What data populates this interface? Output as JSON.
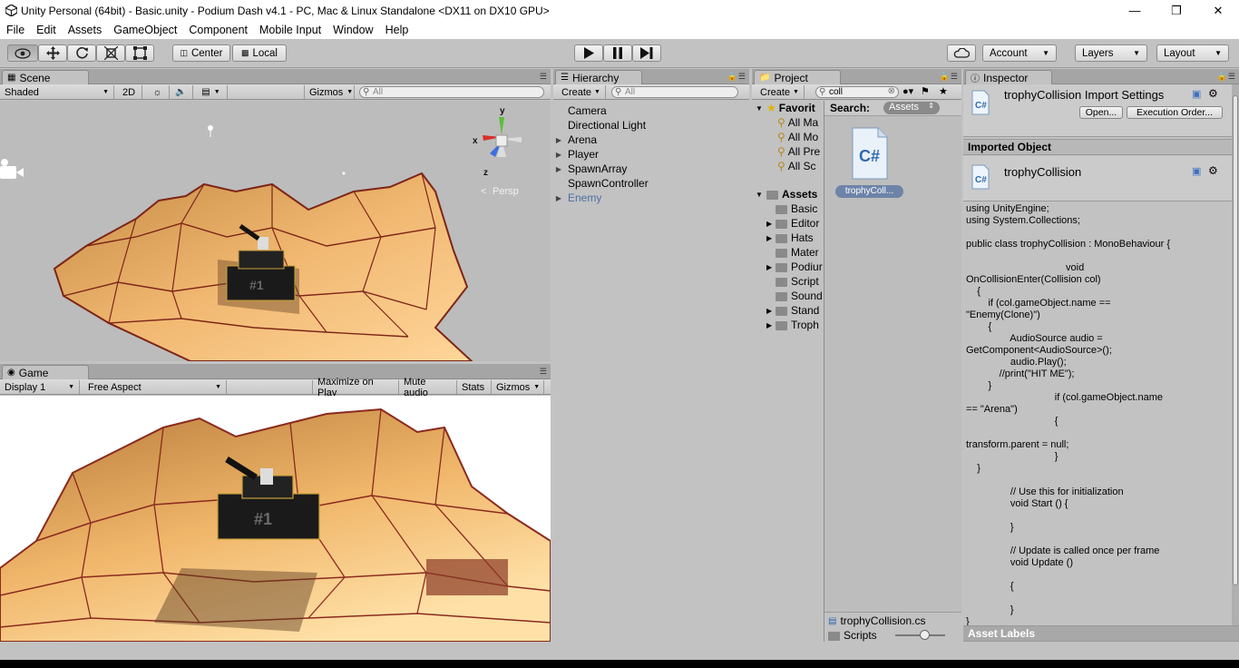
{
  "window": {
    "title": "Unity Personal (64bit) - Basic.unity - Podium Dash v4.1 - PC, Mac & Linux Standalone <DX11 on DX10 GPU>"
  },
  "menu": [
    "File",
    "Edit",
    "Assets",
    "GameObject",
    "Component",
    "Mobile Input",
    "Window",
    "Help"
  ],
  "toolbar": {
    "center": "Center",
    "local": "Local",
    "account": "Account",
    "layers": "Layers",
    "layout": "Layout"
  },
  "scene": {
    "tab": "Scene",
    "shading": "Shaded",
    "mode2d": "2D",
    "gizmos": "Gizmos",
    "search_placeholder": "All",
    "persp": "Persp",
    "axis_x": "x",
    "axis_y": "y",
    "axis_z": "z"
  },
  "game": {
    "tab": "Game",
    "display": "Display 1",
    "aspect": "Free Aspect",
    "maximize": "Maximize on Play",
    "mute": "Mute audio",
    "stats": "Stats",
    "gizmos": "Gizmos"
  },
  "hierarchy": {
    "tab": "Hierarchy",
    "create": "Create",
    "search_placeholder": "All",
    "items": [
      {
        "label": "Camera",
        "arrow": ""
      },
      {
        "label": "Directional Light",
        "arrow": ""
      },
      {
        "label": "Arena",
        "arrow": "▶"
      },
      {
        "label": "Player",
        "arrow": "▶"
      },
      {
        "label": "SpawnArray",
        "arrow": "▶"
      },
      {
        "label": "SpawnController",
        "arrow": ""
      },
      {
        "label": "Enemy",
        "arrow": "▶"
      }
    ]
  },
  "project": {
    "tab": "Project",
    "create": "Create",
    "search_value": "coll",
    "search_label": "Search:",
    "search_scope": "Assets",
    "favorites_label": "Favorit",
    "favorites": [
      "All Ma",
      "All Mo",
      "All Pre",
      "All Sc"
    ],
    "assets_label": "Assets",
    "assets": [
      {
        "label": "Basic",
        "arrow": ""
      },
      {
        "label": "Editor",
        "arrow": "▶"
      },
      {
        "label": "Hats",
        "arrow": "▶"
      },
      {
        "label": "Mater",
        "arrow": ""
      },
      {
        "label": "Podiur",
        "arrow": "▶"
      },
      {
        "label": "Script",
        "arrow": ""
      },
      {
        "label": "Sound",
        "arrow": ""
      },
      {
        "label": "Stand",
        "arrow": "▶"
      },
      {
        "label": "Troph",
        "arrow": "▶"
      }
    ],
    "result_name": "trophyColl...",
    "result_icon": "C#",
    "footer_file": "trophyCollision.cs",
    "footer_folder": "Scripts"
  },
  "inspector": {
    "tab": "Inspector",
    "title": "trophyCollision Import Settings",
    "open": "Open...",
    "exec_order": "Execution Order...",
    "imported_object": "Imported Object",
    "object_name": "trophyCollision",
    "code": "using UnityEngine;\nusing System.Collections;\n\npublic class trophyCollision : MonoBehaviour {\n\n                                    void\nOnCollisionEnter(Collision col)\n    {\n        if (col.gameObject.name ==\n\"Enemy(Clone)\")\n        {\n                AudioSource audio =\nGetComponent<AudioSource>();\n                audio.Play();\n            //print(\"HIT ME\");\n        }\n                                if (col.gameObject.name\n== \"Arena\")\n                                {\n\ntransform.parent = null;\n                                }\n    }\n\n                // Use this for initialization\n                void Start () {\n\n                }\n\n                // Update is called once per frame\n                void Update ()\n\n                {\n\n                }\n}",
    "asset_labels": "Asset Labels"
  },
  "colors": {
    "bg": "#c2c2c2",
    "tab_strip": "#a5a5a5",
    "sky": "#bdbdbd",
    "terrain": "#e8a65c",
    "terrain_edge": "#8a2a1e",
    "selection_blue": "#3d6fbf",
    "enemy_text": "#4f6fa8"
  },
  "icons": [
    "unity-logo-icon",
    "view-tool-icon",
    "move-tool-icon",
    "rotate-tool-icon",
    "scale-tool-icon",
    "rect-tool-icon",
    "play-icon",
    "pause-icon",
    "step-icon",
    "cloud-icon",
    "lock-icon",
    "star-icon",
    "csharp-file-icon",
    "folder-icon",
    "search-icon",
    "sun-icon",
    "speaker-icon",
    "image-icon",
    "camera-icon",
    "light-icon",
    "help-icon",
    "settings-icon"
  ]
}
